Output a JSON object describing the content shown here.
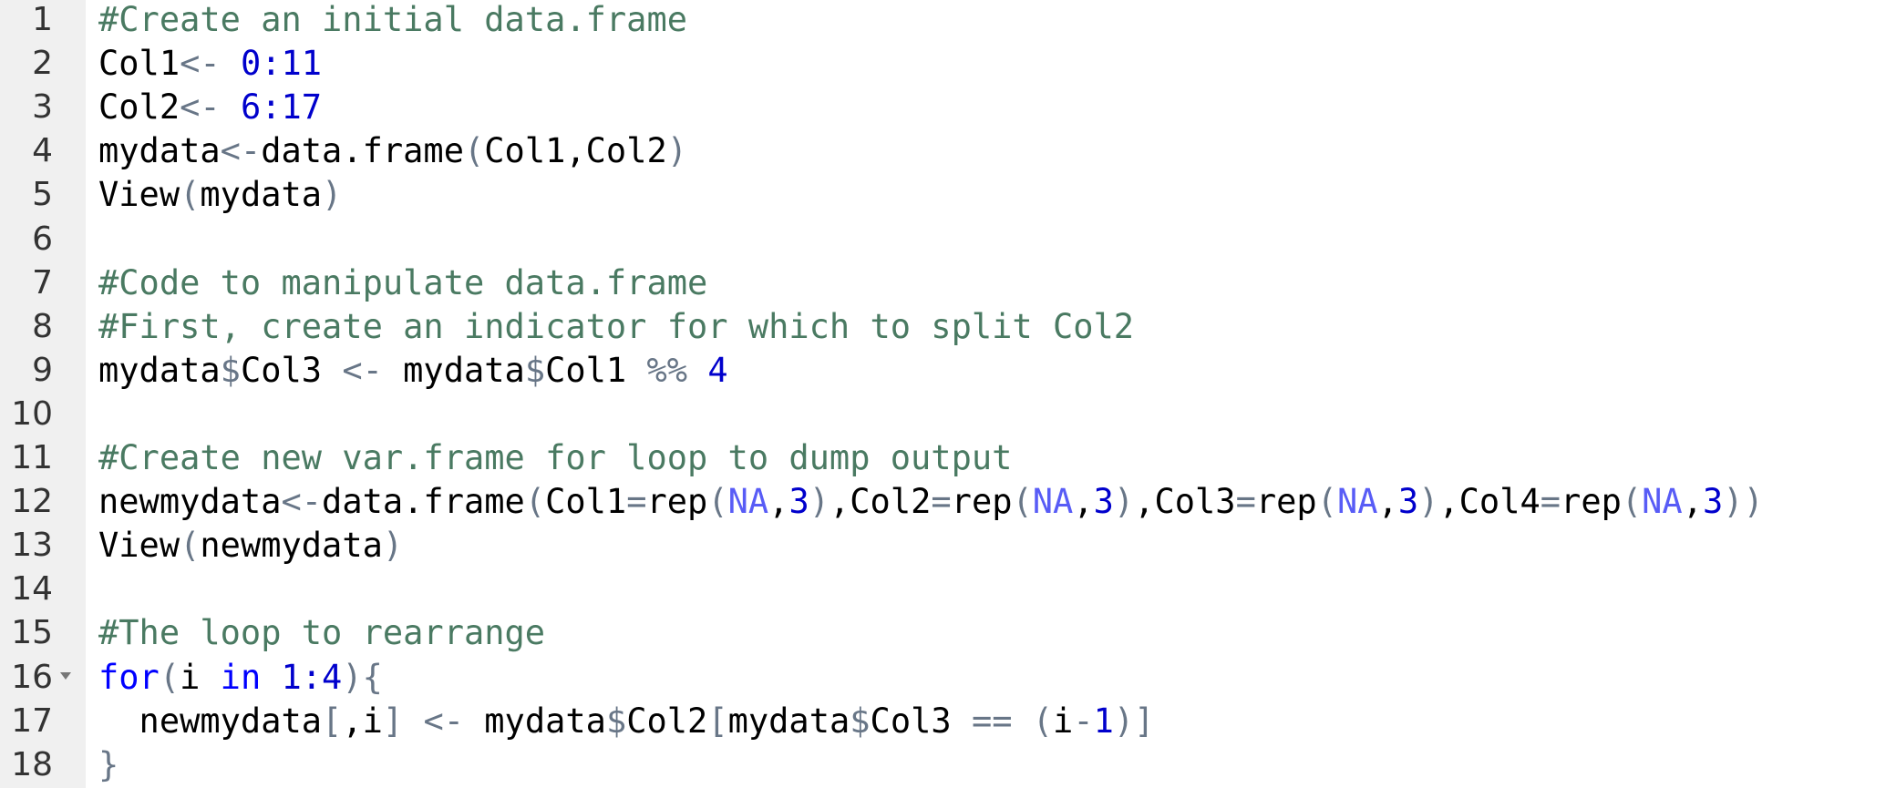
{
  "editor": {
    "colors": {
      "comment": "#4a7a62",
      "number": "#0000cc",
      "keyword": "#0000ff",
      "operator": "#687687",
      "constant": "#585cf6",
      "gutter_bg": "#f0f0f0"
    },
    "fold_line": 16,
    "lines": [
      {
        "n": "1",
        "tokens": [
          {
            "t": "#Create an initial data.frame",
            "c": "comment"
          }
        ]
      },
      {
        "n": "2",
        "tokens": [
          {
            "t": "Col1",
            "c": "ident"
          },
          {
            "t": "<- ",
            "c": "operator"
          },
          {
            "t": "0:11",
            "c": "number"
          }
        ]
      },
      {
        "n": "3",
        "tokens": [
          {
            "t": "Col2",
            "c": "ident"
          },
          {
            "t": "<- ",
            "c": "operator"
          },
          {
            "t": "6:17",
            "c": "number"
          }
        ]
      },
      {
        "n": "4",
        "tokens": [
          {
            "t": "mydata",
            "c": "ident"
          },
          {
            "t": "<-",
            "c": "operator"
          },
          {
            "t": "data.frame",
            "c": "ident"
          },
          {
            "t": "(",
            "c": "paren"
          },
          {
            "t": "Col1",
            "c": "ident"
          },
          {
            "t": ",",
            "c": "ident"
          },
          {
            "t": "Col2",
            "c": "ident"
          },
          {
            "t": ")",
            "c": "paren"
          }
        ]
      },
      {
        "n": "5",
        "tokens": [
          {
            "t": "View",
            "c": "ident"
          },
          {
            "t": "(",
            "c": "paren"
          },
          {
            "t": "mydata",
            "c": "ident"
          },
          {
            "t": ")",
            "c": "paren"
          }
        ]
      },
      {
        "n": "6",
        "tokens": []
      },
      {
        "n": "7",
        "tokens": [
          {
            "t": "#Code to manipulate data.frame",
            "c": "comment"
          }
        ]
      },
      {
        "n": "8",
        "tokens": [
          {
            "t": "#First, create an indicator for which to split Col2",
            "c": "comment"
          }
        ]
      },
      {
        "n": "9",
        "tokens": [
          {
            "t": "mydata",
            "c": "ident"
          },
          {
            "t": "$",
            "c": "operator"
          },
          {
            "t": "Col3 ",
            "c": "ident"
          },
          {
            "t": "<- ",
            "c": "operator"
          },
          {
            "t": "mydata",
            "c": "ident"
          },
          {
            "t": "$",
            "c": "operator"
          },
          {
            "t": "Col1 ",
            "c": "ident"
          },
          {
            "t": "%% ",
            "c": "operator"
          },
          {
            "t": "4",
            "c": "number"
          }
        ]
      },
      {
        "n": "10",
        "tokens": []
      },
      {
        "n": "11",
        "tokens": [
          {
            "t": "#Create new var.frame for loop to dump output",
            "c": "comment"
          }
        ]
      },
      {
        "n": "12",
        "tokens": [
          {
            "t": "newmydata",
            "c": "ident"
          },
          {
            "t": "<-",
            "c": "operator"
          },
          {
            "t": "data.frame",
            "c": "ident"
          },
          {
            "t": "(",
            "c": "paren"
          },
          {
            "t": "Col1",
            "c": "ident"
          },
          {
            "t": "=",
            "c": "operator"
          },
          {
            "t": "rep",
            "c": "ident"
          },
          {
            "t": "(",
            "c": "paren"
          },
          {
            "t": "NA",
            "c": "const"
          },
          {
            "t": ",",
            "c": "ident"
          },
          {
            "t": "3",
            "c": "number"
          },
          {
            "t": ")",
            "c": "paren"
          },
          {
            "t": ",",
            "c": "ident"
          },
          {
            "t": "Col2",
            "c": "ident"
          },
          {
            "t": "=",
            "c": "operator"
          },
          {
            "t": "rep",
            "c": "ident"
          },
          {
            "t": "(",
            "c": "paren"
          },
          {
            "t": "NA",
            "c": "const"
          },
          {
            "t": ",",
            "c": "ident"
          },
          {
            "t": "3",
            "c": "number"
          },
          {
            "t": ")",
            "c": "paren"
          },
          {
            "t": ",",
            "c": "ident"
          },
          {
            "t": "Col3",
            "c": "ident"
          },
          {
            "t": "=",
            "c": "operator"
          },
          {
            "t": "rep",
            "c": "ident"
          },
          {
            "t": "(",
            "c": "paren"
          },
          {
            "t": "NA",
            "c": "const"
          },
          {
            "t": ",",
            "c": "ident"
          },
          {
            "t": "3",
            "c": "number"
          },
          {
            "t": ")",
            "c": "paren"
          },
          {
            "t": ",",
            "c": "ident"
          },
          {
            "t": "Col4",
            "c": "ident"
          },
          {
            "t": "=",
            "c": "operator"
          },
          {
            "t": "rep",
            "c": "ident"
          },
          {
            "t": "(",
            "c": "paren"
          },
          {
            "t": "NA",
            "c": "const"
          },
          {
            "t": ",",
            "c": "ident"
          },
          {
            "t": "3",
            "c": "number"
          },
          {
            "t": "))",
            "c": "paren"
          }
        ]
      },
      {
        "n": "13",
        "tokens": [
          {
            "t": "View",
            "c": "ident"
          },
          {
            "t": "(",
            "c": "paren"
          },
          {
            "t": "newmydata",
            "c": "ident"
          },
          {
            "t": ")",
            "c": "paren"
          }
        ]
      },
      {
        "n": "14",
        "tokens": []
      },
      {
        "n": "15",
        "tokens": [
          {
            "t": "#The loop to rearrange",
            "c": "comment"
          }
        ]
      },
      {
        "n": "16",
        "tokens": [
          {
            "t": "for",
            "c": "keyword"
          },
          {
            "t": "(",
            "c": "paren"
          },
          {
            "t": "i ",
            "c": "ident"
          },
          {
            "t": "in ",
            "c": "keyword"
          },
          {
            "t": "1:4",
            "c": "number"
          },
          {
            "t": "){",
            "c": "paren"
          }
        ]
      },
      {
        "n": "17",
        "tokens": [
          {
            "t": "  newmydata",
            "c": "ident"
          },
          {
            "t": "[",
            "c": "paren"
          },
          {
            "t": ",",
            "c": "ident"
          },
          {
            "t": "i",
            "c": "ident"
          },
          {
            "t": "] ",
            "c": "paren"
          },
          {
            "t": "<- ",
            "c": "operator"
          },
          {
            "t": "mydata",
            "c": "ident"
          },
          {
            "t": "$",
            "c": "operator"
          },
          {
            "t": "Col2",
            "c": "ident"
          },
          {
            "t": "[",
            "c": "paren"
          },
          {
            "t": "mydata",
            "c": "ident"
          },
          {
            "t": "$",
            "c": "operator"
          },
          {
            "t": "Col3 ",
            "c": "ident"
          },
          {
            "t": "== ",
            "c": "operator"
          },
          {
            "t": "(",
            "c": "paren"
          },
          {
            "t": "i",
            "c": "ident"
          },
          {
            "t": "-",
            "c": "operator"
          },
          {
            "t": "1",
            "c": "number"
          },
          {
            "t": ")]",
            "c": "paren"
          }
        ]
      },
      {
        "n": "18",
        "tokens": [
          {
            "t": "}",
            "c": "paren"
          }
        ]
      }
    ]
  }
}
